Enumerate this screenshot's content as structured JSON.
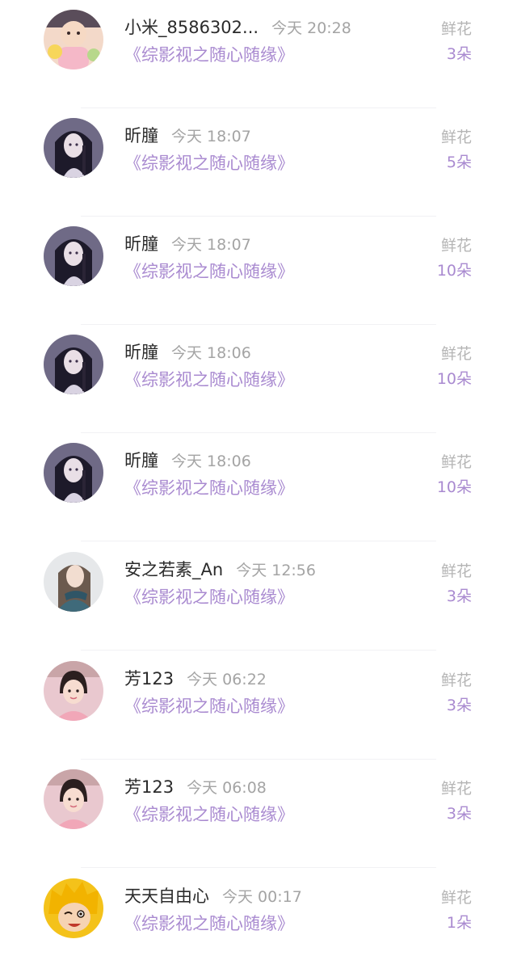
{
  "items": [
    {
      "name": "小米_8586302...",
      "time": "今天 20:28",
      "book": "《综影视之随心随缘》",
      "gift_label": "鲜花",
      "gift_count": "3朵"
    },
    {
      "name": "昕朣",
      "time": "今天 18:07",
      "book": "《综影视之随心随缘》",
      "gift_label": "鲜花",
      "gift_count": "5朵"
    },
    {
      "name": "昕朣",
      "time": "今天 18:07",
      "book": "《综影视之随心随缘》",
      "gift_label": "鲜花",
      "gift_count": "10朵"
    },
    {
      "name": "昕朣",
      "time": "今天 18:06",
      "book": "《综影视之随心随缘》",
      "gift_label": "鲜花",
      "gift_count": "10朵"
    },
    {
      "name": "昕朣",
      "time": "今天 18:06",
      "book": "《综影视之随心随缘》",
      "gift_label": "鲜花",
      "gift_count": "10朵"
    },
    {
      "name": "安之若素_An",
      "time": "今天 12:56",
      "book": "《综影视之随心随缘》",
      "gift_label": "鲜花",
      "gift_count": "3朵"
    },
    {
      "name": "芳123",
      "time": "今天 06:22",
      "book": "《综影视之随心随缘》",
      "gift_label": "鲜花",
      "gift_count": "3朵"
    },
    {
      "name": "芳123",
      "time": "今天 06:08",
      "book": "《综影视之随心随缘》",
      "gift_label": "鲜花",
      "gift_count": "3朵"
    },
    {
      "name": "天天自由心",
      "time": "今天 00:17",
      "book": "《综影视之随心随缘》",
      "gift_label": "鲜花",
      "gift_count": "1朵"
    }
  ],
  "colors": {
    "accent": "#a98ad0",
    "name_text": "#2b2b2b",
    "secondary_text": "#a4a4a4"
  }
}
